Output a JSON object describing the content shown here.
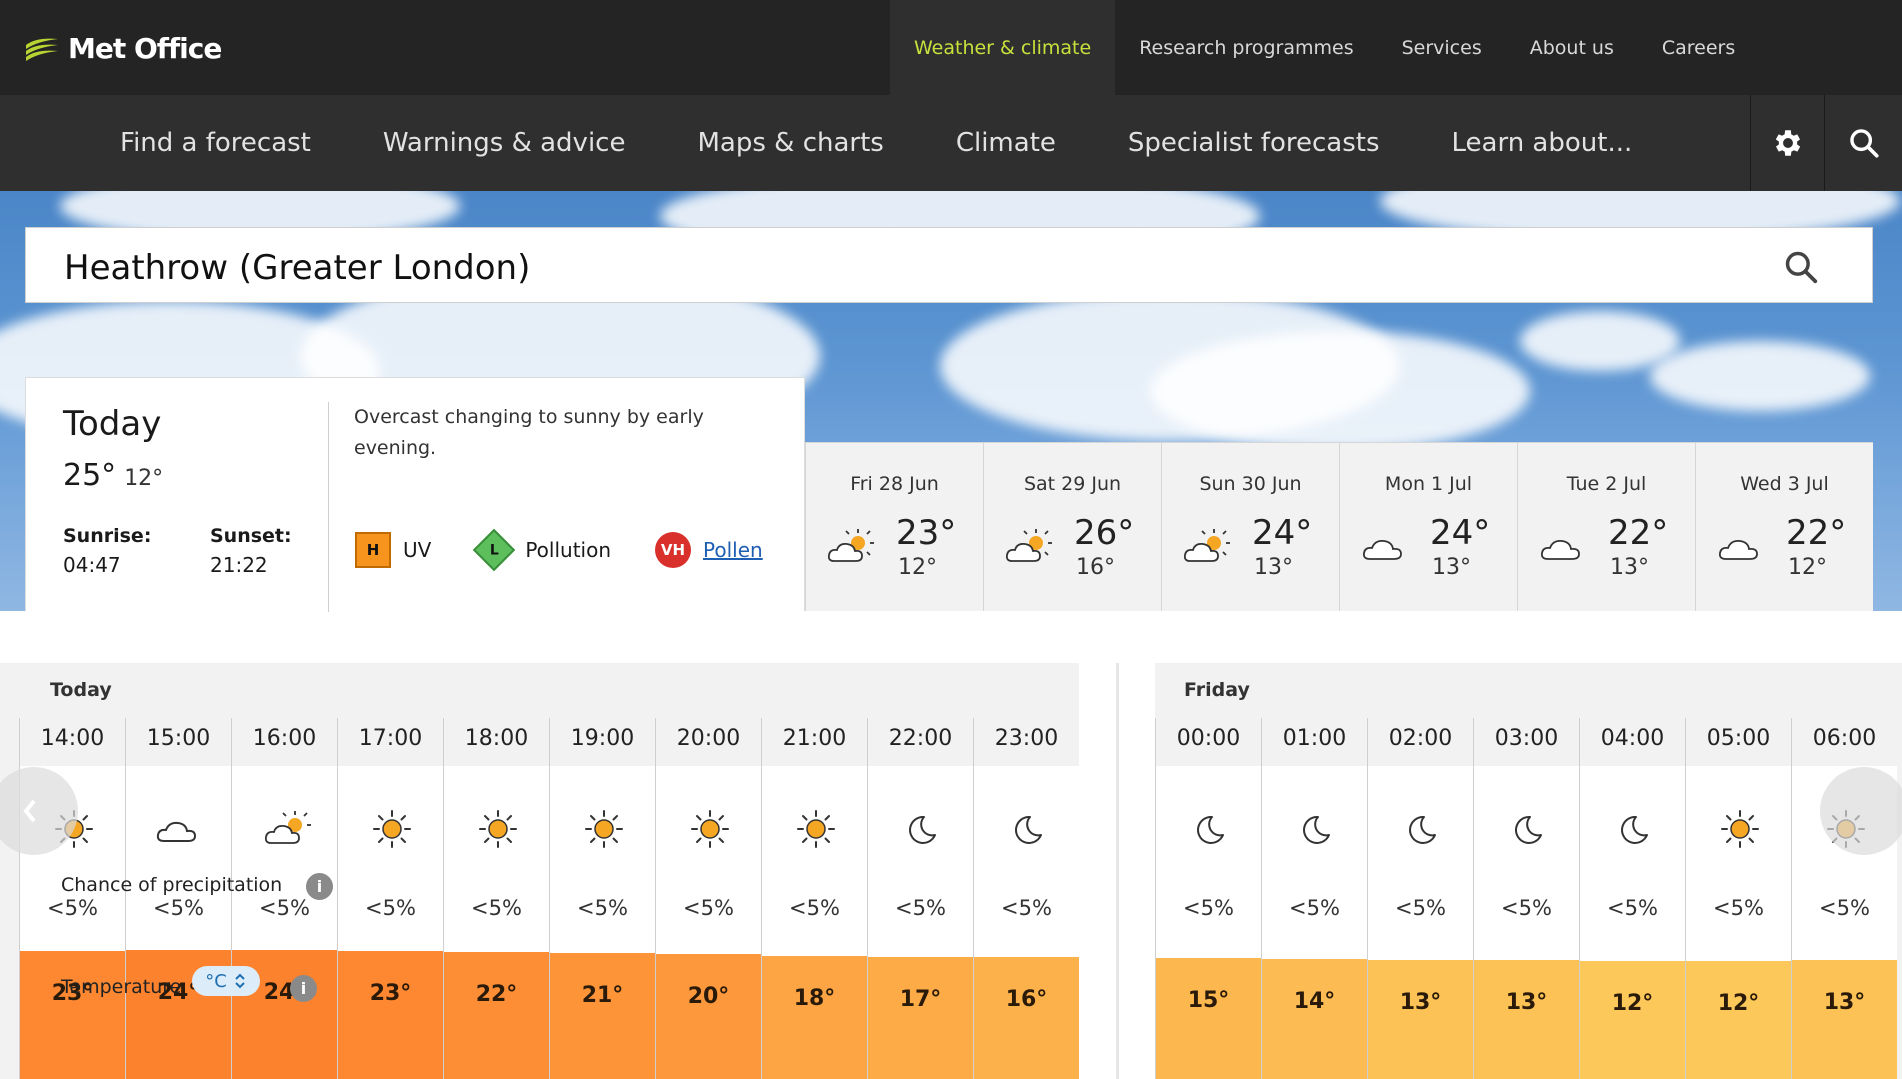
{
  "brand": {
    "logo_text": "Met Office"
  },
  "top_nav": [
    {
      "label": "Weather & climate",
      "active": true
    },
    {
      "label": "Research programmes",
      "active": false
    },
    {
      "label": "Services",
      "active": false
    },
    {
      "label": "About us",
      "active": false
    },
    {
      "label": "Careers",
      "active": false
    }
  ],
  "sec_nav": [
    {
      "label": "Find a forecast"
    },
    {
      "label": "Warnings & advice"
    },
    {
      "label": "Maps & charts"
    },
    {
      "label": "Climate"
    },
    {
      "label": "Specialist forecasts"
    },
    {
      "label": "Learn about..."
    }
  ],
  "icons": {
    "settings": "gear-icon",
    "search": "search-icon"
  },
  "location": {
    "value": "Heathrow (Greater London)"
  },
  "today": {
    "title": "Today",
    "high": "25°",
    "low": "12°",
    "sunrise_label": "Sunrise:",
    "sunrise": "04:47",
    "sunset_label": "Sunset:",
    "sunset": "21:22",
    "summary": "Overcast changing to sunny by early evening.",
    "uv": {
      "badge": "H",
      "label": "UV"
    },
    "pollution": {
      "badge": "L",
      "label": "Pollution"
    },
    "pollen": {
      "badge": "VH",
      "label": "Pollen"
    }
  },
  "days": [
    {
      "name": "Fri 28 Jun",
      "high": "23°",
      "low": "12°",
      "icon": "sun-cloud-icon"
    },
    {
      "name": "Sat 29 Jun",
      "high": "26°",
      "low": "16°",
      "icon": "sun-cloud-icon"
    },
    {
      "name": "Sun 30 Jun",
      "high": "24°",
      "low": "13°",
      "icon": "sun-cloud-icon"
    },
    {
      "name": "Mon 1 Jul",
      "high": "24°",
      "low": "13°",
      "icon": "cloud-icon"
    },
    {
      "name": "Tue 2 Jul",
      "high": "22°",
      "low": "13°",
      "icon": "cloud-icon"
    },
    {
      "name": "Wed 3 Jul",
      "high": "22°",
      "low": "12°",
      "icon": "cloud-icon"
    }
  ],
  "hourly_today": {
    "label": "Today",
    "hours": [
      {
        "time": "14:00",
        "icon": "sun",
        "precip": "<5%",
        "temp": "23°"
      },
      {
        "time": "15:00",
        "icon": "cloud",
        "precip": "<5%",
        "temp": "24°"
      },
      {
        "time": "16:00",
        "icon": "sun-cloud",
        "precip": "<5%",
        "temp": "24°"
      },
      {
        "time": "17:00",
        "icon": "sun",
        "precip": "<5%",
        "temp": "23°"
      },
      {
        "time": "18:00",
        "icon": "sun",
        "precip": "<5%",
        "temp": "22°"
      },
      {
        "time": "19:00",
        "icon": "sun",
        "precip": "<5%",
        "temp": "21°"
      },
      {
        "time": "20:00",
        "icon": "sun",
        "precip": "<5%",
        "temp": "20°"
      },
      {
        "time": "21:00",
        "icon": "sun",
        "precip": "<5%",
        "temp": "18°"
      },
      {
        "time": "22:00",
        "icon": "moon",
        "precip": "<5%",
        "temp": "17°"
      },
      {
        "time": "23:00",
        "icon": "moon",
        "precip": "<5%",
        "temp": "16°"
      }
    ]
  },
  "hourly_friday": {
    "label": "Friday",
    "hours": [
      {
        "time": "00:00",
        "icon": "moon",
        "precip": "<5%",
        "temp": "15°"
      },
      {
        "time": "01:00",
        "icon": "moon",
        "precip": "<5%",
        "temp": "14°"
      },
      {
        "time": "02:00",
        "icon": "moon",
        "precip": "<5%",
        "temp": "13°"
      },
      {
        "time": "03:00",
        "icon": "moon",
        "precip": "<5%",
        "temp": "13°"
      },
      {
        "time": "04:00",
        "icon": "moon",
        "precip": "<5%",
        "temp": "12°"
      },
      {
        "time": "05:00",
        "icon": "sun",
        "precip": "<5%",
        "temp": "12°"
      },
      {
        "time": "06:00",
        "icon": "sun",
        "precip": "<5%",
        "temp": "13°"
      }
    ]
  },
  "labels": {
    "precip": "Chance of precipitation",
    "temperature": "Temperature",
    "unit": "°C",
    "info": "i"
  },
  "colors": {
    "accent": "#c8e03c",
    "sun": "#f5a623",
    "uv_high": "#f7941d",
    "pollen_very_high": "#d9302b"
  }
}
